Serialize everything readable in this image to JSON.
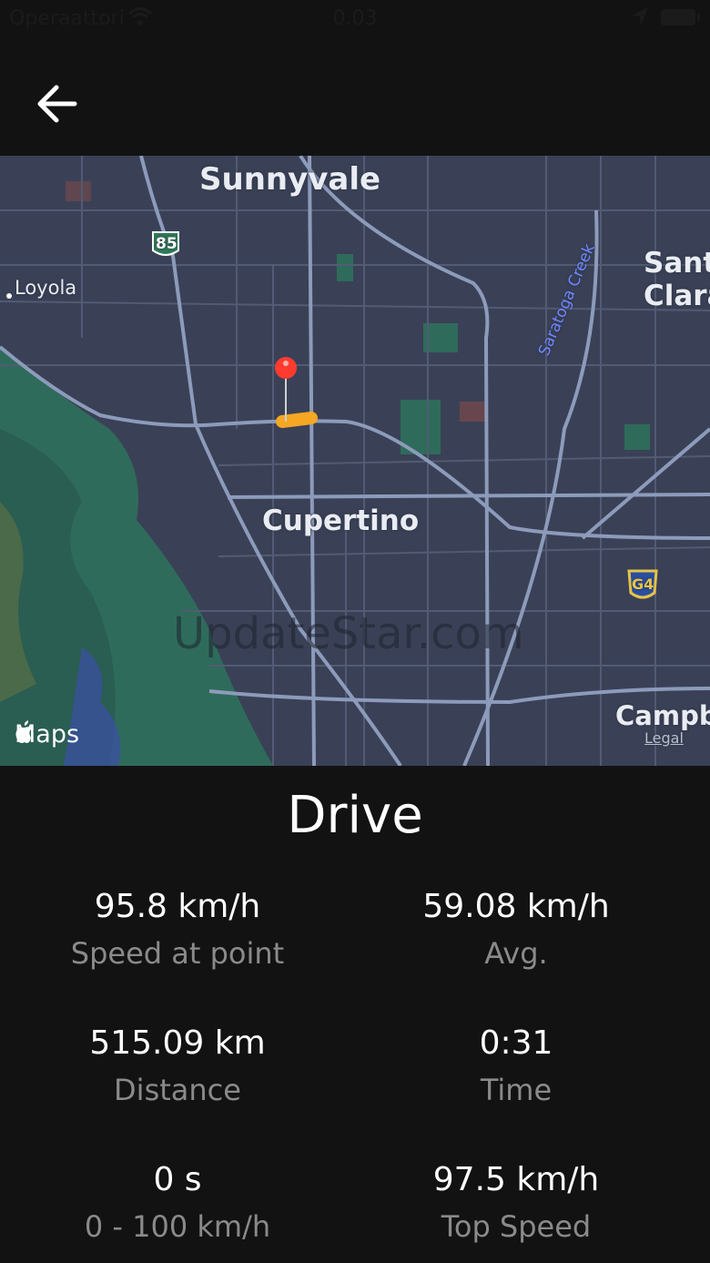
{
  "status_bar": {
    "carrier": "Operaattori",
    "time": "0.03"
  },
  "map": {
    "labels": {
      "sunnyvale": "Sunnyvale",
      "cupertino": "Cupertino",
      "loyola": "Loyola",
      "santa_clara": "Santa Clara",
      "campbell": "Campbe",
      "creek": "Saratoga Creek",
      "hwy_85": "85",
      "hwy_g4": "G4",
      "maps_brand": "Maps",
      "legal": "Legal",
      "watermark": "UpdateStar.com"
    },
    "colors": {
      "base": "#3a4156",
      "park": "#2f6b5b",
      "road": "#8d9bbb",
      "route": "#f5a623",
      "pin": "#ff3b30"
    }
  },
  "title": "Drive",
  "stats": [
    {
      "value": "95.8 km/h",
      "label": "Speed at point"
    },
    {
      "value": "59.08 km/h",
      "label": "Avg."
    },
    {
      "value": "515.09 km",
      "label": "Distance"
    },
    {
      "value": "0:31",
      "label": "Time"
    },
    {
      "value": "0 s",
      "label": "0 - 100 km/h"
    },
    {
      "value": "97.5 km/h",
      "label": "Top Speed"
    }
  ]
}
